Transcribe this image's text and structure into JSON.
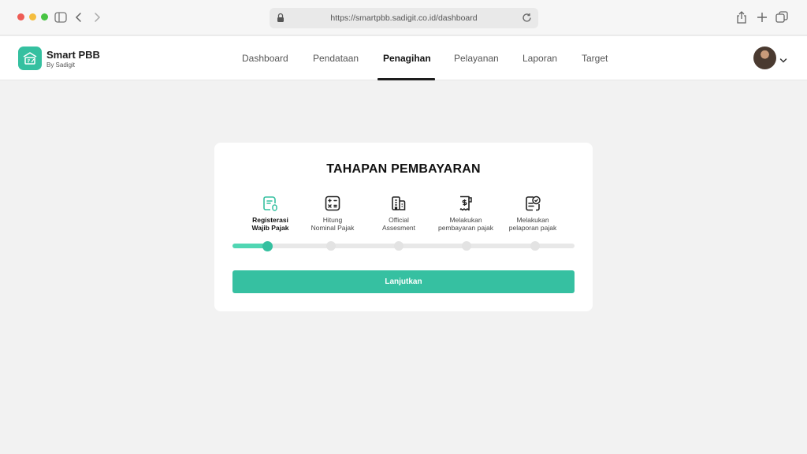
{
  "browser": {
    "url": "https://smartpbb.sadigit.co.id/dashboard"
  },
  "brand": {
    "name": "Smart PBB",
    "subtitle": "By Sadigit",
    "accent_color": "#35c0a0"
  },
  "nav": {
    "items": [
      {
        "label": "Dashboard",
        "active": false
      },
      {
        "label": "Pendataan",
        "active": false
      },
      {
        "label": "Penagihan",
        "active": true
      },
      {
        "label": "Pelayanan",
        "active": false
      },
      {
        "label": "Laporan",
        "active": false
      },
      {
        "label": "Target",
        "active": false
      }
    ]
  },
  "card": {
    "title": "TAHAPAN PEMBAYARAN",
    "steps": [
      {
        "label": "Registerasi\nWajib Pajak",
        "icon": "registration-doc-icon",
        "current": true
      },
      {
        "label": "Hitung\nNominal Pajak",
        "icon": "calculator-icon",
        "current": false
      },
      {
        "label": "Official\nAssesment",
        "icon": "building-icon",
        "current": false
      },
      {
        "label": "Melakukan\npembayaran pajak",
        "icon": "receipt-icon",
        "current": false
      },
      {
        "label": "Melakukan\npelaporan pajak",
        "icon": "report-check-icon",
        "current": false
      }
    ],
    "progress_step": 1,
    "button_label": "Lanjutkan"
  }
}
